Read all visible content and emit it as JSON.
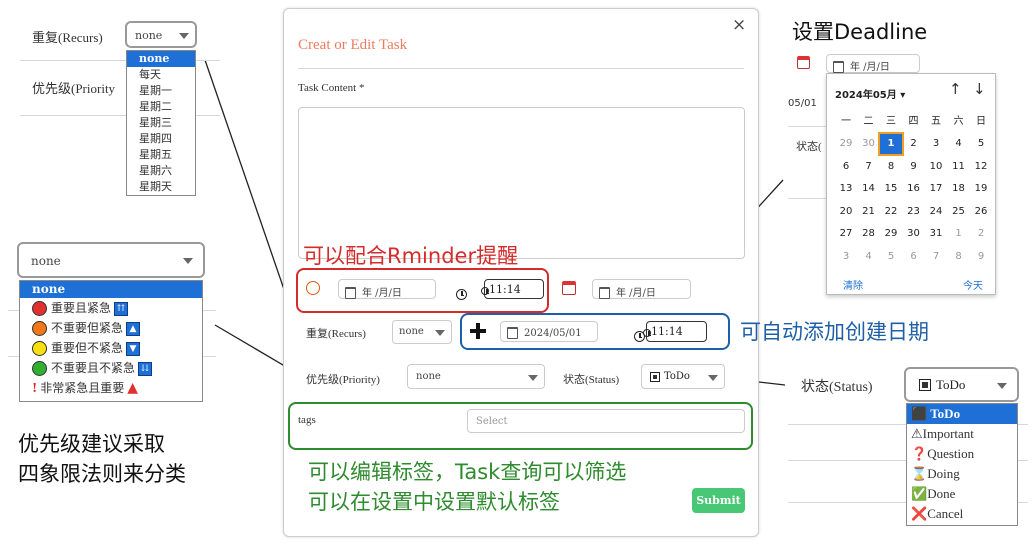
{
  "annotations": {
    "set_deadline": "设置Deadline",
    "reminder": "可以配合Rminder提醒",
    "auto_add_date": "可自动添加创建日期",
    "tags_note_line1": "可以编辑标签，Task查询可以筛选",
    "tags_note_line2": "可以在设置中设置默认标签",
    "priority_note_line1": "优先级建议采取",
    "priority_note_line2": "四象限法则来分类"
  },
  "repeat_panel": {
    "label": "重复(Recurs)",
    "selected": "none",
    "priority_label_partial": "优先级(Priority",
    "options": [
      "none",
      "每天",
      "星期一",
      "星期二",
      "星期三",
      "星期四",
      "星期五",
      "星期六",
      "星期天"
    ]
  },
  "priority_panel": {
    "selected": "none",
    "options": [
      {
        "label": "none",
        "dot": "",
        "icon": ""
      },
      {
        "label": "重要且紧急",
        "dot": "#e03030",
        "icon": "⏫"
      },
      {
        "label": "不重要但紧急",
        "dot": "#f07818",
        "icon": "🔼"
      },
      {
        "label": "重要但不紧急",
        "dot": "#f8e010",
        "icon": "🔽"
      },
      {
        "label": "不重要且不紧急",
        "dot": "#30b030",
        "icon": "⏬"
      },
      {
        "label": "非常紧急且重要",
        "dot": "",
        "icon": "🔺"
      }
    ],
    "mark_exclaim": "!",
    "mark_triangle": "▲",
    "icon_up2": "⇈",
    "icon_up": "▲",
    "icon_down": "▼",
    "icon_down2": "⇊"
  },
  "modal": {
    "title": "Creat or Edit Task",
    "close": "×",
    "content_label": "Task Content *",
    "reminder_date_placeholder": "年 /月/日",
    "reminder_time": "11:14",
    "deadline_date_placeholder": "年 /月/日",
    "recurs_label": "重复(Recurs)",
    "recurs_value": "none",
    "created_date": "2024/05/01",
    "created_time": "11:14",
    "priority_label": "优先级(Priority)",
    "priority_value": "none",
    "status_label": "状态(Status)",
    "status_value": "ToDo",
    "tags_label": "tags",
    "tags_placeholder": "Select",
    "submit": "Submit"
  },
  "calendar": {
    "input_placeholder": "年 /月/日",
    "month_label": "2024年05月",
    "prev": "↑",
    "next": "↓",
    "weekdays": [
      "一",
      "二",
      "三",
      "四",
      "五",
      "六",
      "日"
    ],
    "weeks": [
      [
        "29",
        "30",
        "1",
        "2",
        "3",
        "4",
        "5"
      ],
      [
        "6",
        "7",
        "8",
        "9",
        "10",
        "11",
        "12"
      ],
      [
        "13",
        "14",
        "15",
        "16",
        "17",
        "18",
        "19"
      ],
      [
        "20",
        "21",
        "22",
        "23",
        "24",
        "25",
        "26"
      ],
      [
        "27",
        "28",
        "29",
        "30",
        "31",
        "1",
        "2"
      ],
      [
        "3",
        "4",
        "5",
        "6",
        "7",
        "8",
        "9"
      ]
    ],
    "clear": "清除",
    "today": "今天",
    "bg_partial_1": "05/01",
    "bg_partial_2": "状态("
  },
  "status_panel": {
    "label": "状态(Status)",
    "selected": "ToDo",
    "options": [
      {
        "icon": "⬛",
        "label": "ToDo"
      },
      {
        "icon": "⚠",
        "label": "Important"
      },
      {
        "icon": "❓",
        "label": "Question"
      },
      {
        "icon": "⌛",
        "label": "Doing"
      },
      {
        "icon": "✅",
        "label": "Done"
      },
      {
        "icon": "❌",
        "label": "Cancel"
      }
    ]
  }
}
